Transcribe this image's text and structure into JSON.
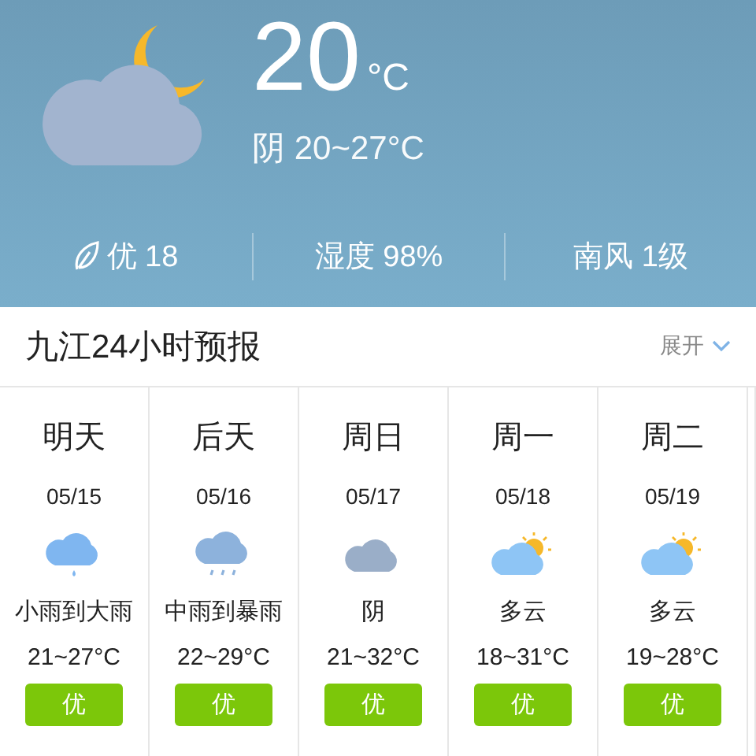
{
  "current": {
    "temperature": "20",
    "unit": "°C",
    "summary": "阴 20~27°C",
    "stats": [
      {
        "kind": "air",
        "text": "优 18"
      },
      {
        "kind": "plain",
        "text": "湿度 98%"
      },
      {
        "kind": "plain",
        "text": "南风 1级"
      }
    ]
  },
  "forecast": {
    "title": "九江24小时预报",
    "toggle": "展开",
    "days": [
      {
        "day": "明天",
        "date": "05/15",
        "kind": "light-rain",
        "condition": "小雨到大雨",
        "range": "21~27°C",
        "aqi": "优"
      },
      {
        "day": "后天",
        "date": "05/16",
        "kind": "heavy-rain",
        "condition": "中雨到暴雨",
        "range": "22~29°C",
        "aqi": "优"
      },
      {
        "day": "周日",
        "date": "05/17",
        "kind": "overcast",
        "condition": "阴",
        "range": "21~32°C",
        "aqi": "优"
      },
      {
        "day": "周一",
        "date": "05/18",
        "kind": "partly-cloudy",
        "condition": "多云",
        "range": "18~31°C",
        "aqi": "优"
      },
      {
        "day": "周二",
        "date": "05/19",
        "kind": "partly-cloudy",
        "condition": "多云",
        "range": "19~28°C",
        "aqi": "优"
      }
    ]
  }
}
